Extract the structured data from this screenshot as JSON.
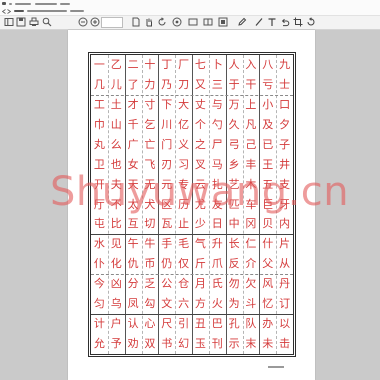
{
  "toolbar": {
    "file_tools": [
      "sidebar-icon",
      "save-icon",
      "print-icon",
      "find-icon"
    ],
    "zoom_tools": [
      "zoom-out-icon",
      "zoom-in-icon"
    ],
    "view_tools": [
      "page-view-icon",
      "hand-tool-icon",
      "rotate-icon",
      "snapshot-icon",
      "single-page-icon",
      "two-page-icon",
      "fit-page-icon"
    ],
    "annotation_tools": [
      "highlight-pen-icon",
      "line-tool-icon",
      "text-tool-icon",
      "undo-icon",
      "crop-icon",
      "refresh-icon"
    ]
  },
  "document": {
    "grid": {
      "rows": [
        [
          "一",
          "乙",
          "二",
          "十",
          "丁",
          "厂",
          "七",
          "卜",
          "人",
          "入",
          "八",
          "九"
        ],
        [
          "几",
          "儿",
          "了",
          "力",
          "乃",
          "刀",
          "又",
          "三",
          "于",
          "干",
          "亏",
          "士"
        ],
        [
          "工",
          "土",
          "才",
          "寸",
          "下",
          "大",
          "丈",
          "与",
          "万",
          "上",
          "小",
          "口"
        ],
        [
          "巾",
          "山",
          "千",
          "乞",
          "川",
          "亿",
          "个",
          "勺",
          "久",
          "凡",
          "及",
          "夕"
        ],
        [
          "丸",
          "么",
          "广",
          "亡",
          "门",
          "义",
          "之",
          "尸",
          "弓",
          "己",
          "已",
          "子"
        ],
        [
          "卫",
          "也",
          "女",
          "飞",
          "刃",
          "习",
          "叉",
          "马",
          "乡",
          "丰",
          "王",
          "井"
        ],
        [
          "开",
          "夫",
          "天",
          "无",
          "元",
          "专",
          "云",
          "扎",
          "艺",
          "木",
          "五",
          "支"
        ],
        [
          "厅",
          "不",
          "太",
          "犬",
          "区",
          "历",
          "尤",
          "友",
          "匹",
          "车",
          "巨",
          "牙"
        ],
        [
          "屯",
          "比",
          "互",
          "切",
          "瓦",
          "止",
          "少",
          "日",
          "中",
          "冈",
          "贝",
          "内"
        ],
        [
          "水",
          "见",
          "午",
          "牛",
          "手",
          "毛",
          "气",
          "升",
          "长",
          "仁",
          "什",
          "片"
        ],
        [
          "仆",
          "化",
          "仇",
          "币",
          "仍",
          "仅",
          "斤",
          "爪",
          "反",
          "介",
          "父",
          "从"
        ],
        [
          "今",
          "凶",
          "分",
          "乏",
          "公",
          "仓",
          "月",
          "氏",
          "勿",
          "欠",
          "风",
          "丹"
        ],
        [
          "匀",
          "乌",
          "凤",
          "勾",
          "文",
          "六",
          "方",
          "火",
          "为",
          "斗",
          "忆",
          "订"
        ],
        [
          "计",
          "户",
          "认",
          "心",
          "尺",
          "引",
          "丑",
          "巴",
          "孔",
          "队",
          "办",
          "以"
        ],
        [
          "允",
          "予",
          "劝",
          "双",
          "书",
          "幻",
          "玉",
          "刊",
          "示",
          "末",
          "未",
          "击"
        ]
      ]
    },
    "watermark": "Shuyuwang.cn"
  },
  "colors": {
    "character": "#d43a3a",
    "watermark": "#e35b5b",
    "viewer_background": "#cacaca",
    "page": "#ffffff"
  }
}
